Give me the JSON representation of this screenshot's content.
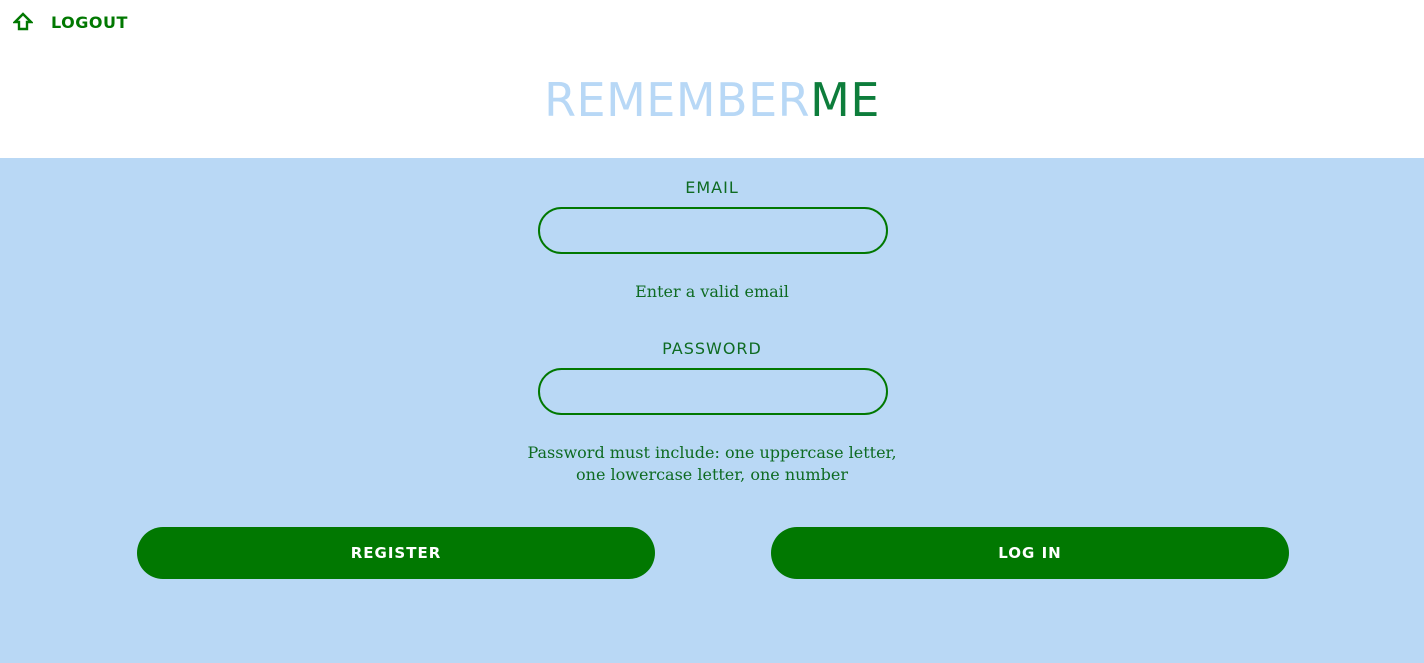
{
  "header": {
    "logout_icon": "home-icon",
    "logout_label": "LOGOUT"
  },
  "brand": {
    "part1": "REMEMBER",
    "part2": "ME"
  },
  "form": {
    "email_label": "EMAIL",
    "email_value": "",
    "email_hint": "Enter a valid email",
    "password_label": "PASSWORD",
    "password_value": "",
    "password_hint_line1": "Password must include: one uppercase letter,",
    "password_hint_line2": "one lowercase letter, one number",
    "register_label": "REGISTER",
    "login_label": "LOG IN"
  },
  "colors": {
    "primary_green": "#017801",
    "panel_blue": "#b9d8f5",
    "brand_light": "#b8d8f6",
    "brand_dark": "#0d7d3b"
  }
}
